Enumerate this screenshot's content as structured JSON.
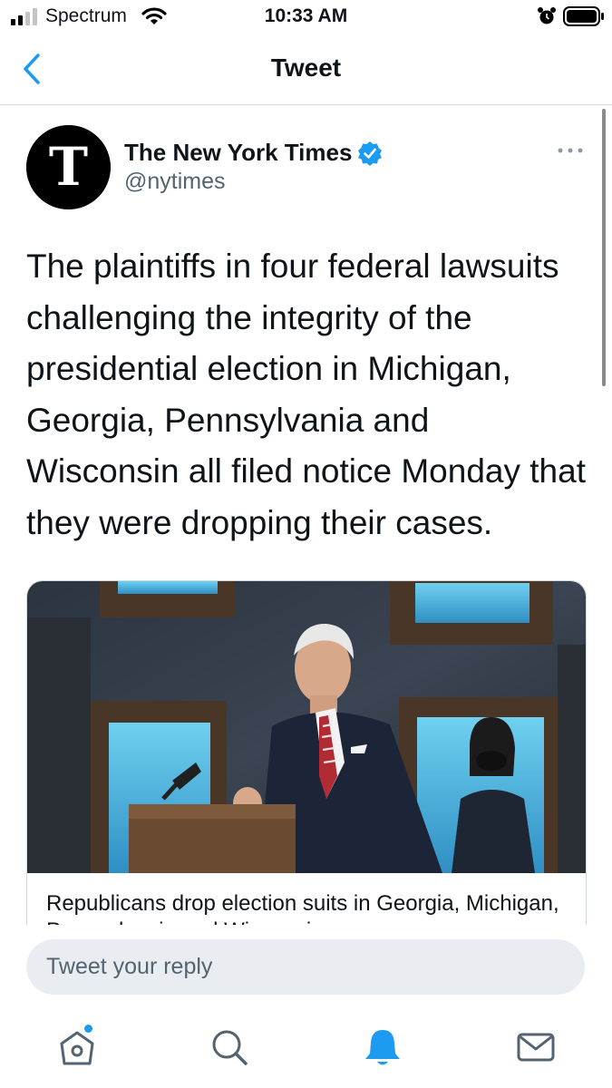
{
  "status_bar": {
    "carrier": "Spectrum",
    "time": "10:33 AM"
  },
  "nav": {
    "title": "Tweet"
  },
  "tweet": {
    "author_name": "The New York Times",
    "author_handle": "@nytimes",
    "verified": true,
    "text": "The plaintiffs in four federal lawsuits challenging the integrity of the presidential election in Michigan, Georgia, Pennsylvania and Wisconsin all filed notice Monday that they were dropping their cases.",
    "card": {
      "title": "Republicans drop election suits in Georgia, Michigan, Pennsylvania and Wisconsin"
    }
  },
  "reply": {
    "placeholder": "Tweet your reply"
  },
  "tab_bar": {
    "items": [
      "home-icon",
      "search-icon",
      "notifications-icon",
      "messages-icon"
    ],
    "active": "notifications-icon"
  },
  "colors": {
    "accent": "#1d9bf0",
    "secondary_text": "#536471",
    "divider": "#cfd9de",
    "reply_field": "#e9edf1"
  }
}
